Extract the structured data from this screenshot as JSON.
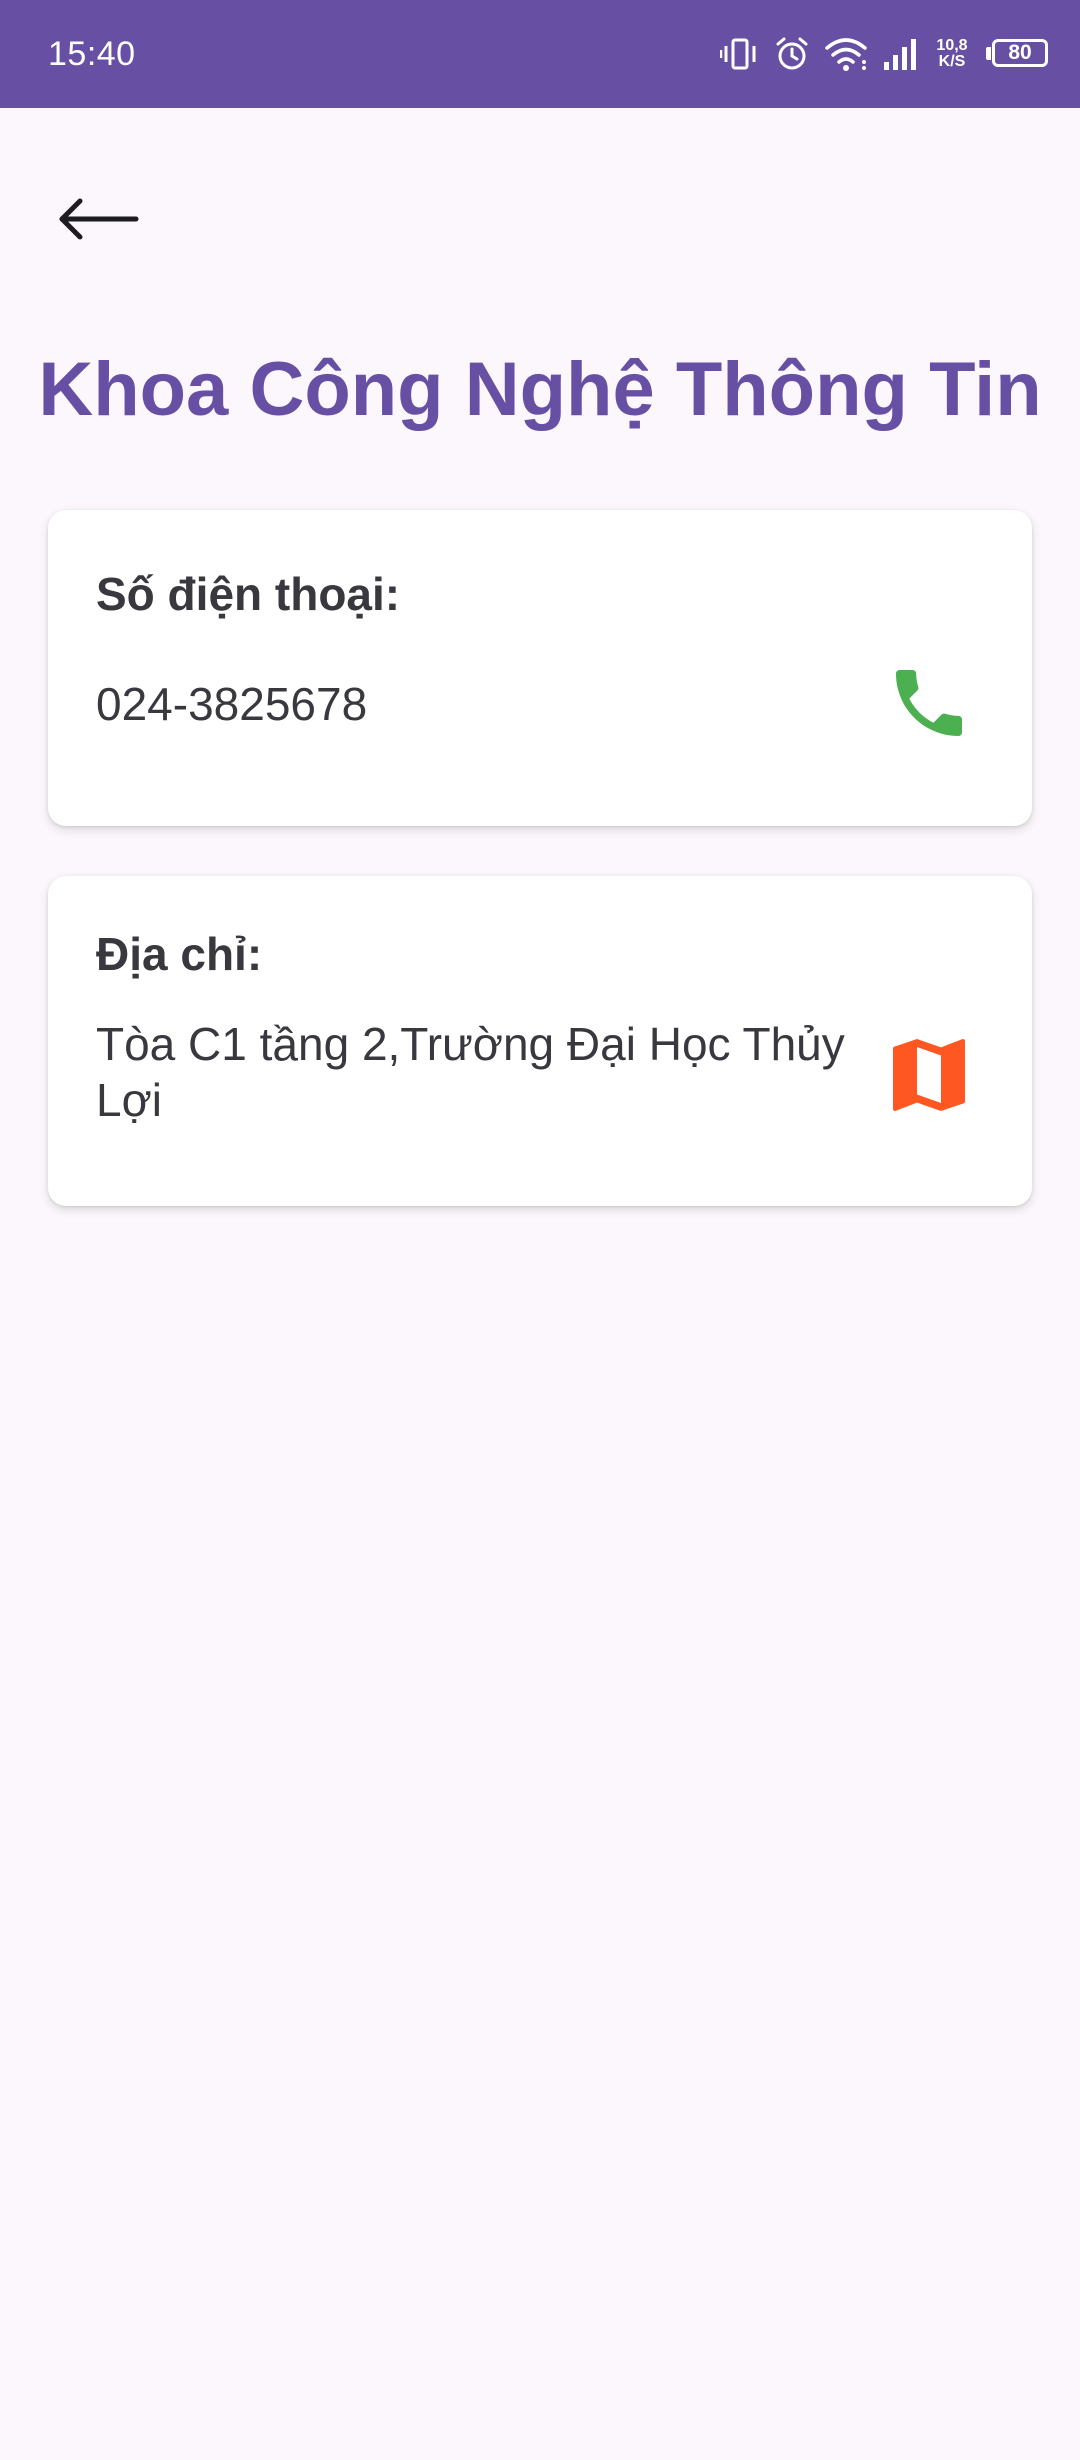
{
  "status_bar": {
    "time": "15:40",
    "net_speed_value": "10,8",
    "net_speed_unit": "K/S",
    "battery": "80"
  },
  "header": {
    "title": "Khoa Công Nghệ Thông Tin"
  },
  "contact": {
    "phone_label": "Số điện thoại:",
    "phone_value": "024-3825678",
    "address_label": "Địa chỉ:",
    "address_value": "Tòa C1 tầng 2,Trường Đại Học Thủy Lợi"
  },
  "icons": {
    "back": "arrow-back-icon",
    "call": "phone-icon",
    "map": "map-icon"
  },
  "colors": {
    "primary": "#6750A4",
    "background": "#FCF7FC",
    "phone_icon": "#4CAF50",
    "map_icon": "#FF5722"
  }
}
